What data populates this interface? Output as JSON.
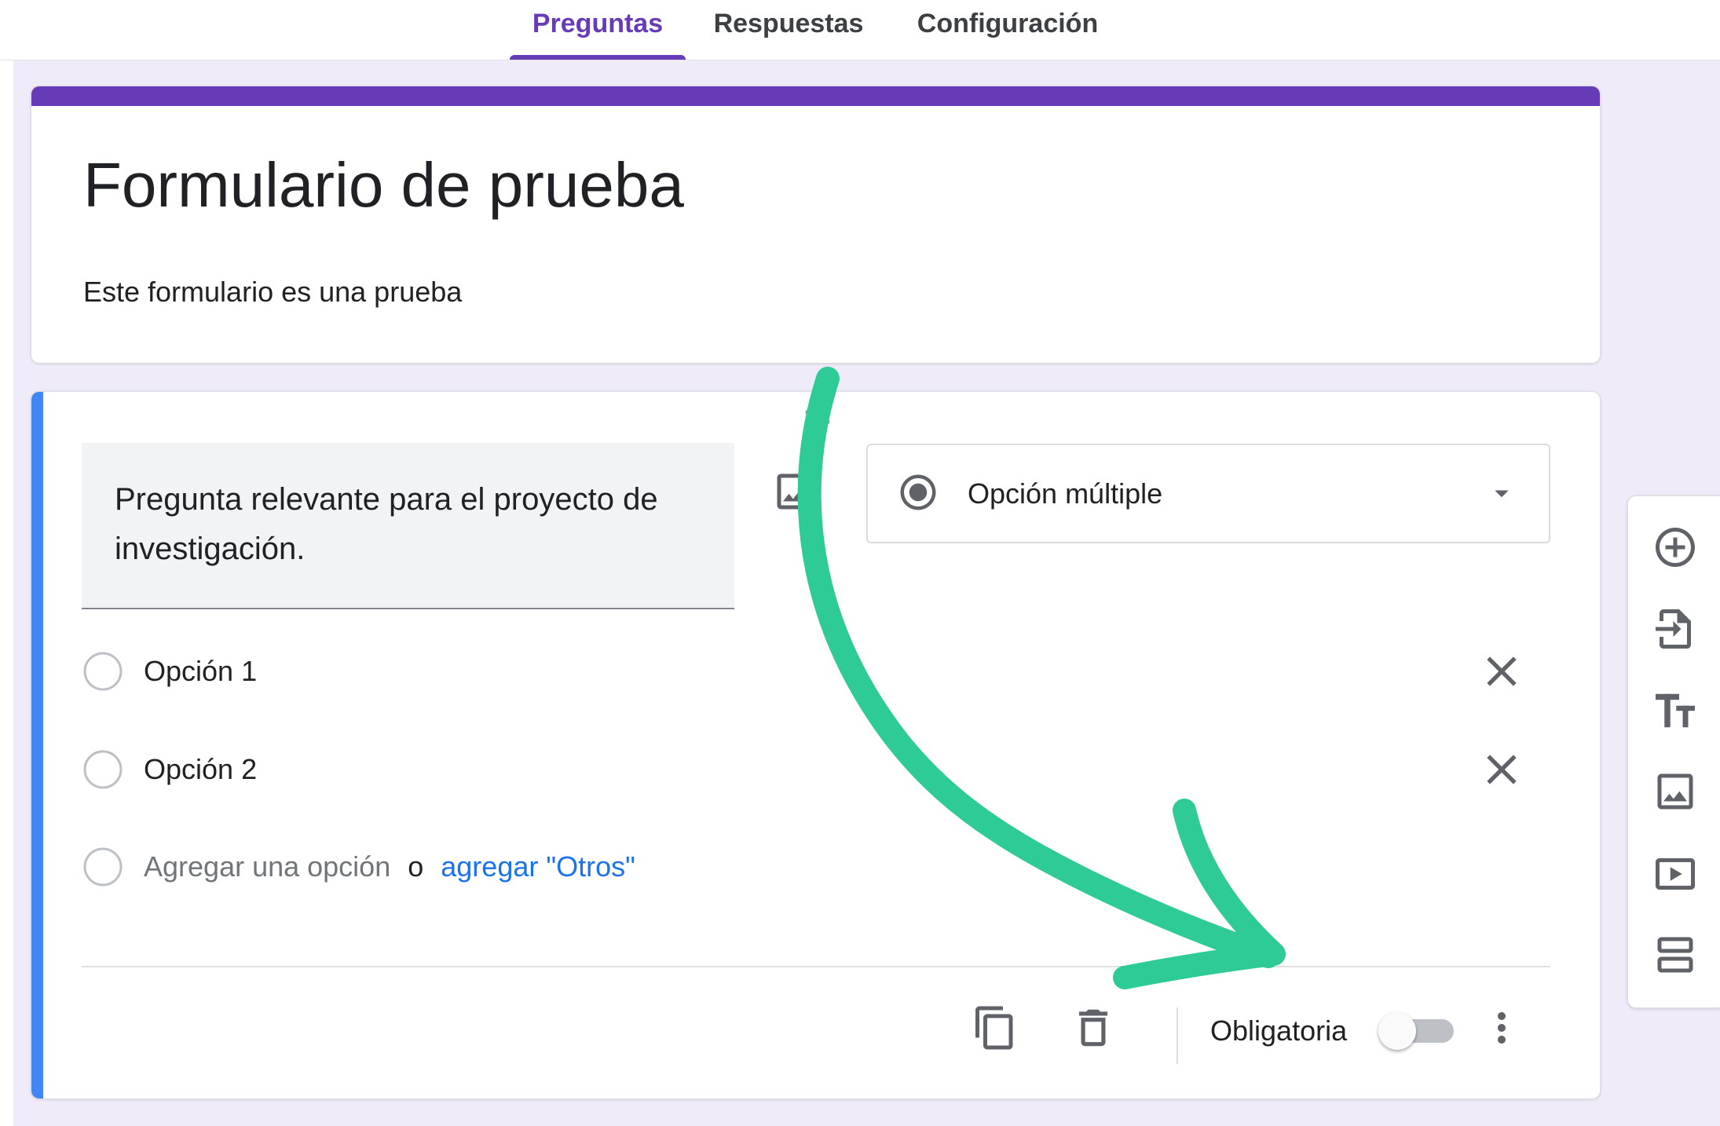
{
  "tabs": [
    {
      "label": "Preguntas",
      "active": true
    },
    {
      "label": "Respuestas",
      "active": false
    },
    {
      "label": "Configuración",
      "active": false
    }
  ],
  "form": {
    "title": "Formulario de prueba",
    "description": "Este formulario es una prueba"
  },
  "question": {
    "title": "Pregunta relevante para el proyecto de investigación.",
    "type": "Opción múltiple",
    "options": [
      "Opción 1",
      "Opción 2"
    ],
    "add_option": {
      "label": "Agregar una opción",
      "separator": "o",
      "other_link": "agregar \"Otros\""
    },
    "required_label": "Obligatoria",
    "required": false
  },
  "icons": {
    "question": [
      "drag-handle-icon",
      "image-icon",
      "radio-checked-icon",
      "dropdown-arrow-icon",
      "close-icon"
    ],
    "footer": [
      "copy-icon",
      "trash-icon",
      "more-vert-icon"
    ],
    "side_toolbar": [
      "add-circle-icon",
      "import-icon",
      "title-text-icon",
      "image-icon",
      "video-icon",
      "section-icon"
    ]
  },
  "colors": {
    "accent": "#673ab7",
    "active_question": "#4285f4",
    "link": "#1a73e8",
    "canvas": "#f0ebf8",
    "annotation_arrow": "#2fcb96"
  }
}
